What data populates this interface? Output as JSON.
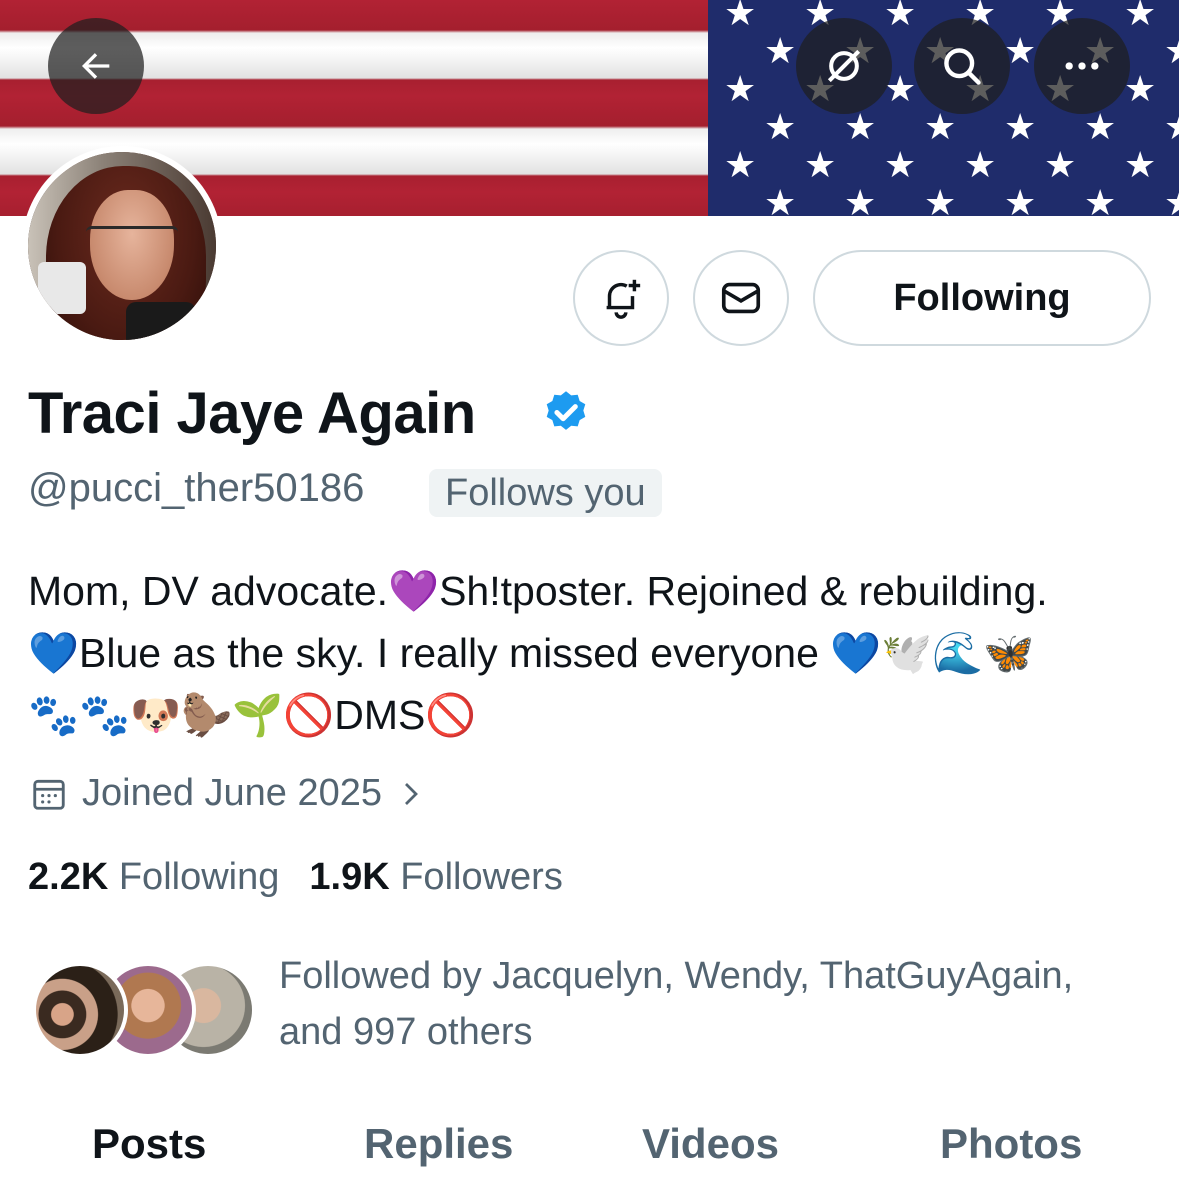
{
  "header": {
    "back_icon": "arrow-left-icon",
    "grok_icon": "grok-icon",
    "search_icon": "search-icon",
    "more_icon": "more-dots-icon"
  },
  "actions": {
    "notify_icon": "bell-plus-icon",
    "message_icon": "envelope-icon",
    "follow_label": "Following"
  },
  "profile": {
    "display_name": "Traci Jaye Again",
    "handle": "@pucci_ther50186",
    "follows_you": "Follows you",
    "bio_lines": [
      "Mom, DV advocate.💜Sh!tposter. Rejoined & rebuilding.",
      "💙Blue as the sky. I really missed everyone 💙🕊️🌊🦋",
      "🐾🐾🐶🦫🌱🚫DMS🚫"
    ],
    "joined": "Joined June 2025",
    "following_count": "2.2K",
    "following_label": "Following",
    "followers_count": "1.9K",
    "followers_label": "Followers",
    "followed_by_line1": "Followed by Jacquelyn, Wendy, ThatGuyAgain,",
    "followed_by_line2": "and 997 others"
  },
  "tabs": [
    {
      "label": "Posts",
      "active": true
    },
    {
      "label": "Replies",
      "active": false
    },
    {
      "label": "Videos",
      "active": false
    },
    {
      "label": "Photos",
      "active": false
    }
  ],
  "colors": {
    "verified": "#1d9bf0",
    "secondary_text": "#536471",
    "primary_text": "#0f1419"
  }
}
